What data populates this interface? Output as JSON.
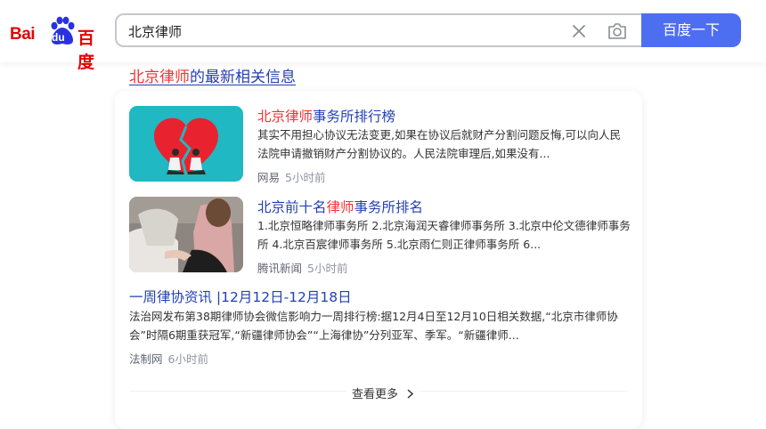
{
  "search": {
    "query": "北京律师",
    "button_label": "百度一下"
  },
  "logo": {
    "part1": "Bai",
    "part2": "du",
    "part3": "百度"
  },
  "news_heading": {
    "highlight": "北京律师",
    "rest": "的最新相关信息"
  },
  "results": [
    {
      "title_hl": "北京律师",
      "title_rest": "事务所排行榜",
      "snippet": "其实不用担心协议无法变更,如果在协议后就财产分割问题反悔,可以向人民法院申请撤销财产分割协议的。人民法院审理后,如果没有...",
      "source": "网易",
      "time": "5小时前"
    },
    {
      "title_pre": "北京前十名",
      "title_hl": "律师",
      "title_rest": "事务所排名",
      "snippet": "1.北京恒略律师事务所 2.北京海润天睿律师事务所 3.北京中伦文德律师事务所 4.北京百宸律师事务所 5.北京雨仁则正律师事务所 6...",
      "source": "腾讯新闻",
      "time": "5小时前"
    },
    {
      "title": "一周律协资讯 |12月12日-12月18日",
      "snippet": "法治网发布第38期律师协会微信影响力一周排行榜:据12月4日至12月10日相关数据,“北京市律师协会”时隔6期重获冠军,“新疆律师协会”“上海律协”分列亚军、季军。“新疆律师...",
      "source": "法制网",
      "time": "6小时前"
    }
  ],
  "more_label": "查看更多",
  "colors": {
    "accent": "#4e6ef2",
    "link": "#2440b3",
    "highlight": "#f73131"
  },
  "icons": [
    "baidu-paw-icon",
    "clear-icon",
    "camera-icon",
    "chevron-right-icon"
  ]
}
